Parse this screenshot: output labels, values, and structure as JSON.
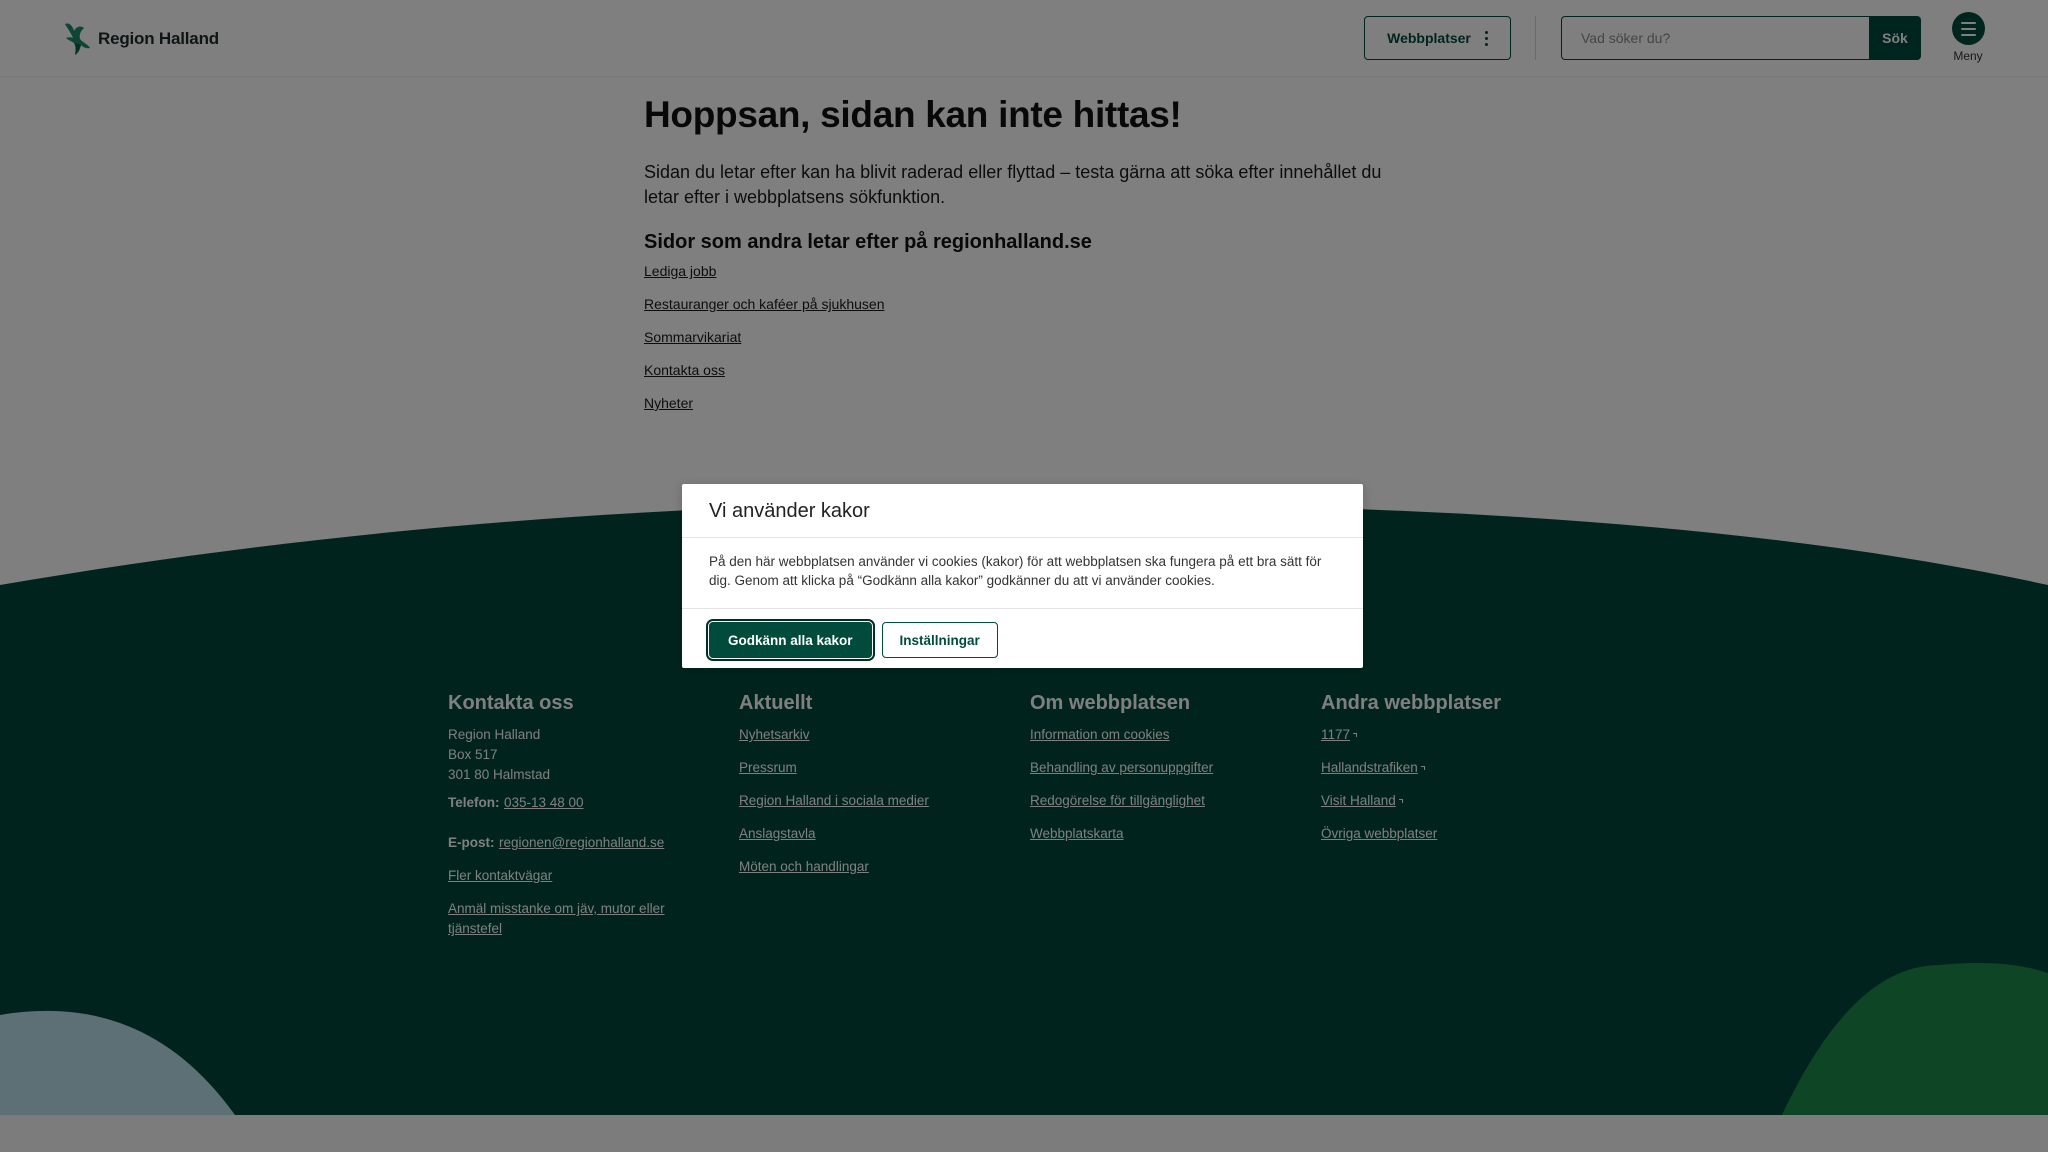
{
  "header": {
    "logo_text": "Region Halland",
    "webbplatser_label": "Webbplatser",
    "search": {
      "placeholder": "Vad söker du?",
      "button_label": "Sök"
    },
    "menu_label": "Meny"
  },
  "main": {
    "title": "Hoppsan, sidan kan inte hittas!",
    "intro": "Sidan du letar efter kan ha blivit raderad eller flyttad – testa gärna att söka efter innehållet du letar efter i webbplatsens sökfunktion.",
    "popular_heading": "Sidor som andra letar efter på regionhalland.se",
    "popular_links": [
      "Lediga jobb",
      "Restauranger och kaféer på sjukhusen",
      "Sommarvikariat",
      "Kontakta oss",
      "Nyheter"
    ]
  },
  "footer": {
    "kontakta": {
      "heading": "Kontakta oss",
      "address": [
        "Region Halland",
        "Box 517",
        "301 80 Halmstad"
      ],
      "phone_label": "Telefon:",
      "phone_value": "035-13 48 00",
      "email_label": "E-post:",
      "email_value": "regionen@regionhalland.se",
      "links": [
        "Fler kontaktvägar",
        "Anmäl misstanke om jäv, mutor eller tjänstefel"
      ]
    },
    "aktuellt": {
      "heading": "Aktuellt",
      "links": [
        "Nyhetsarkiv",
        "Pressrum",
        "Region Halland i sociala medier",
        "Anslagstavla",
        "Möten och handlingar"
      ]
    },
    "om": {
      "heading": "Om webbplatsen",
      "links": [
        "Information om cookies",
        "Behandling av personuppgifter",
        "Redogörelse för tillgänglighet",
        "Webbplatskarta"
      ]
    },
    "andra": {
      "heading": "Andra webbplatser",
      "links": [
        "1177",
        "Hallandstrafiken",
        "Visit Halland",
        "Övriga webbplatser"
      ]
    }
  },
  "cookie_modal": {
    "title": "Vi använder kakor",
    "text": "På den här webbplatsen använder vi cookies (kakor) för att webbplatsen ska fungera på ett bra sätt för dig. Genom att klicka på “Godkänn alla kakor” godkänner du att vi använder cookies.",
    "accept_label": "Godkänn alla kakor",
    "settings_label": "Inställningar"
  },
  "colors": {
    "brand_green": "#004b3c",
    "footer_dark": "#00493b",
    "wave_light_blue": "#b9e0ed",
    "wave_bright_green": "#1a8a4a"
  }
}
